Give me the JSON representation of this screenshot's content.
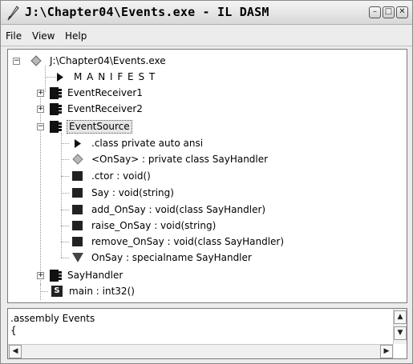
{
  "window": {
    "title": "J:\\Chapter04\\Events.exe - IL DASM",
    "minimize_glyph": "–",
    "maximize_glyph": "□",
    "close_glyph": "✕"
  },
  "menu": {
    "items": [
      "File",
      "View",
      "Help"
    ]
  },
  "tree": {
    "root": {
      "label": "J:\\Chapter04\\Events.exe",
      "icon": "assembly-diamond-icon"
    },
    "manifest": {
      "label": "M A N I F E S T",
      "icon": "triangle-right-icon"
    },
    "receiver1": {
      "label": "EventReceiver1",
      "icon": "class-icon",
      "expander": "+"
    },
    "receiver2": {
      "label": "EventReceiver2",
      "icon": "class-icon",
      "expander": "+"
    },
    "source": {
      "label": "EventSource",
      "icon": "class-icon",
      "expander": "−",
      "selected": true,
      "children": [
        {
          "label": ".class private auto ansi",
          "icon": "triangle-right-icon"
        },
        {
          "label": "<OnSay> : private class SayHandler",
          "icon": "field-diamond-icon"
        },
        {
          "label": ".ctor : void()",
          "icon": "method-icon"
        },
        {
          "label": "Say : void(string)",
          "icon": "method-icon"
        },
        {
          "label": "add_OnSay : void(class SayHandler)",
          "icon": "method-icon"
        },
        {
          "label": "raise_OnSay : void(string)",
          "icon": "method-icon"
        },
        {
          "label": "remove_OnSay : void(class SayHandler)",
          "icon": "method-icon"
        },
        {
          "label": "OnSay : specialname SayHandler",
          "icon": "event-triangle-icon"
        }
      ]
    },
    "sayhandler": {
      "label": "SayHandler",
      "icon": "class-icon",
      "expander": "+"
    },
    "main": {
      "label": "main : int32()",
      "icon": "static-method-icon",
      "icon_letter": "S"
    }
  },
  "bottom": {
    "lines": [
      ".assembly Events",
      "{"
    ],
    "scroll_up": "▲",
    "scroll_down": "▼",
    "scroll_left": "◀",
    "scroll_right": "▶"
  }
}
